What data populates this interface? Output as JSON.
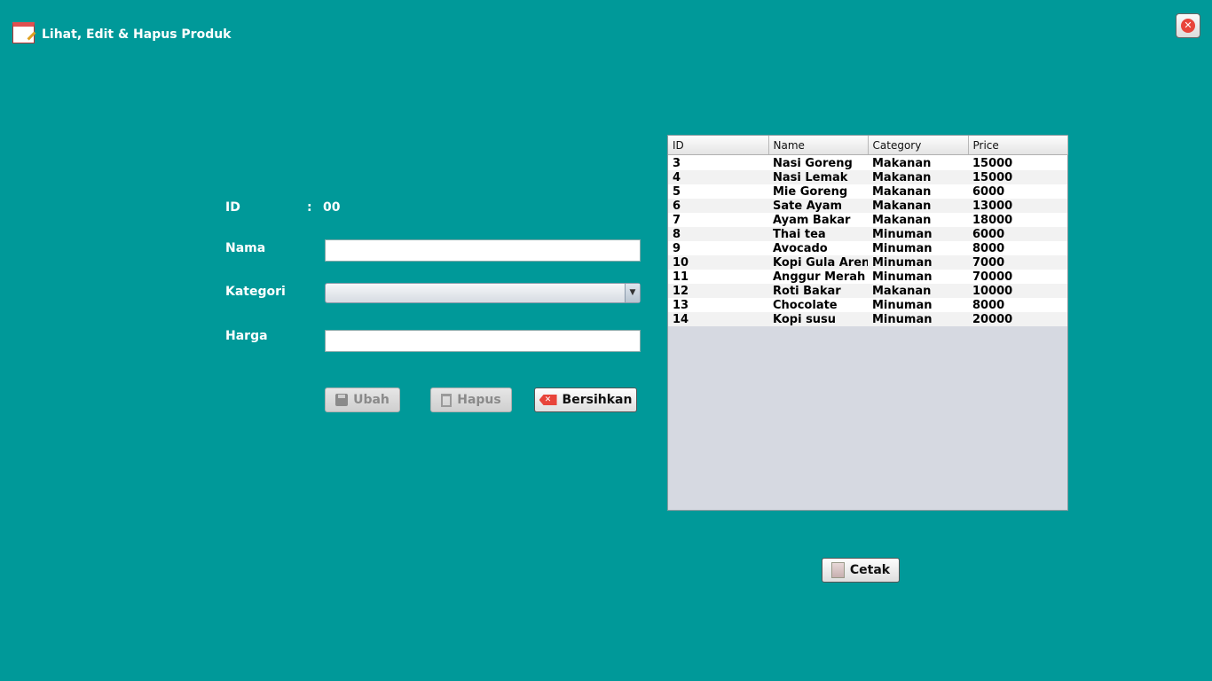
{
  "window": {
    "title": "Lihat, Edit & Hapus Produk",
    "app_icon": "calendar-edit-icon",
    "close_icon": "close-icon"
  },
  "form": {
    "id_label": "ID",
    "id_separator": ":",
    "id_value": "00",
    "nama_label": "Nama",
    "nama_value": "",
    "kategori_label": "Kategori",
    "kategori_value": "",
    "harga_label": "Harga",
    "harga_value": ""
  },
  "buttons": {
    "ubah": "Ubah",
    "hapus": "Hapus",
    "bersihkan": "Bersihkan",
    "cetak": "Cetak"
  },
  "table": {
    "columns": [
      "ID",
      "Name",
      "Category",
      "Price"
    ],
    "rows": [
      [
        "3",
        "Nasi Goreng",
        "Makanan",
        "15000"
      ],
      [
        "4",
        "Nasi Lemak",
        "Makanan",
        "15000"
      ],
      [
        "5",
        "Mie Goreng",
        "Makanan",
        "6000"
      ],
      [
        "6",
        "Sate Ayam",
        "Makanan",
        "13000"
      ],
      [
        "7",
        "Ayam Bakar",
        "Makanan",
        "18000"
      ],
      [
        "8",
        "Thai tea",
        "Minuman",
        "6000"
      ],
      [
        "9",
        "Avocado",
        "Minuman",
        "8000"
      ],
      [
        "10",
        "Kopi Gula Aren",
        "Minuman",
        "7000"
      ],
      [
        "11",
        "Anggur Merah",
        "Minuman",
        "70000"
      ],
      [
        "12",
        "Roti Bakar",
        "Makanan",
        "10000"
      ],
      [
        "13",
        "Chocolate",
        "Minuman",
        "8000"
      ],
      [
        "14",
        "Kopi susu",
        "Minuman",
        "20000"
      ]
    ]
  },
  "colors": {
    "background": "#009999",
    "close_accent": "#e8443a"
  }
}
